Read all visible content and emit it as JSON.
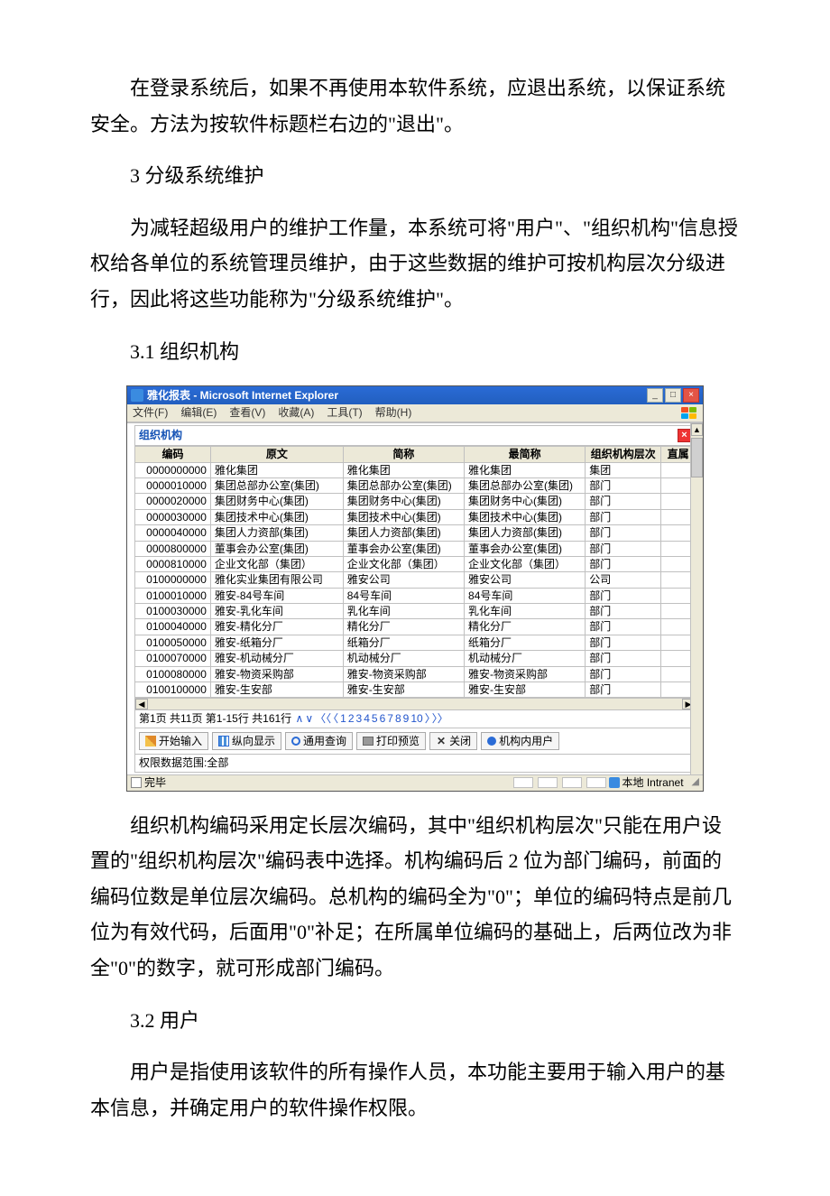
{
  "paragraphs": {
    "p1": "在登录系统后，如果不再使用本软件系统，应退出系统，以保证系统安全。方法为按软件标题栏右边的\"退出\"。",
    "h1": "3 分级系统维护",
    "p2": "为减轻超级用户的维护工作量，本系统可将\"用户\"、\"组织机构\"信息授权给各单位的系统管理员维护，由于这些数据的维护可按机构层次分级进行，因此将这些功能称为\"分级系统维护\"。",
    "h2": "3.1 组织机构",
    "p3": "组织机构编码采用定长层次编码，其中\"组织机构层次\"只能在用户设置的\"组织机构层次\"编码表中选择。机构编码后 2 位为部门编码，前面的编码位数是单位层次编码。总机构的编码全为\"0\"；单位的编码特点是前几位为有效代码，后面用\"0\"补足；在所属单位编码的基础上，后两位改为非全\"0\"的数字，就可形成部门编码。",
    "h3": "3.2 用户",
    "p4": "用户是指使用该软件的所有操作人员，本功能主要用于输入用户的基本信息，并确定用户的软件操作权限。"
  },
  "window": {
    "title": "雅化报表 - Microsoft Internet Explorer",
    "menus": [
      "文件(F)",
      "编辑(E)",
      "查看(V)",
      "收藏(A)",
      "工具(T)",
      "帮助(H)"
    ],
    "panel_title": "组织机构",
    "columns": [
      "编码",
      "原文",
      "简称",
      "最简称",
      "组织机构层次",
      "直属"
    ],
    "rows": [
      [
        "0000000000",
        "雅化集团",
        "雅化集团",
        "雅化集团",
        "集团",
        ""
      ],
      [
        "0000010000",
        "集团总部办公室(集团)",
        "集团总部办公室(集团)",
        "集团总部办公室(集团)",
        "部门",
        ""
      ],
      [
        "0000020000",
        "集团财务中心(集团)",
        "集团财务中心(集团)",
        "集团财务中心(集团)",
        "部门",
        ""
      ],
      [
        "0000030000",
        "集团技术中心(集团)",
        "集团技术中心(集团)",
        "集团技术中心(集团)",
        "部门",
        ""
      ],
      [
        "0000040000",
        "集团人力资部(集团)",
        "集团人力资部(集团)",
        "集团人力资部(集团)",
        "部门",
        ""
      ],
      [
        "0000800000",
        "董事会办公室(集团)",
        "董事会办公室(集团)",
        "董事会办公室(集团)",
        "部门",
        ""
      ],
      [
        "0000810000",
        "企业文化部（集团）",
        "企业文化部（集团）",
        "企业文化部（集团）",
        "部门",
        ""
      ],
      [
        "0100000000",
        "雅化实业集团有限公司",
        "雅安公司",
        "雅安公司",
        "公司",
        ""
      ],
      [
        "0100010000",
        "雅安-84号车间",
        "84号车间",
        "84号车间",
        "部门",
        ""
      ],
      [
        "0100030000",
        "雅安-乳化车间",
        "乳化车间",
        "乳化车间",
        "部门",
        ""
      ],
      [
        "0100040000",
        "雅安-精化分厂",
        "精化分厂",
        "精化分厂",
        "部门",
        ""
      ],
      [
        "0100050000",
        "雅安-纸箱分厂",
        "纸箱分厂",
        "纸箱分厂",
        "部门",
        ""
      ],
      [
        "0100070000",
        "雅安-机动械分厂",
        "机动械分厂",
        "机动械分厂",
        "部门",
        ""
      ],
      [
        "0100080000",
        "雅安-物资采购部",
        "雅安-物资采购部",
        "雅安-物资采购部",
        "部门",
        ""
      ],
      [
        "0100100000",
        "雅安-生安部",
        "雅安-生安部",
        "雅安-生安部",
        "部门",
        ""
      ]
    ],
    "pager_prefix": "第1页 共11页  第1-15行 共161行",
    "pager_links": [
      "∧",
      "∨",
      "〈〈",
      "〈",
      "1",
      "2",
      "3",
      "4",
      "5",
      "6",
      "7",
      "8",
      "9",
      "10",
      "〉",
      "〉〉"
    ],
    "toolbar": [
      {
        "label": "开始输入",
        "icon": "pen"
      },
      {
        "label": "纵向显示",
        "icon": "cols"
      },
      {
        "label": "通用查询",
        "icon": "find"
      },
      {
        "label": "打印预览",
        "icon": "print"
      },
      {
        "label": "关闭",
        "icon": "x"
      },
      {
        "label": "机构内用户",
        "icon": "user"
      }
    ],
    "scope_label": "权限数据范围:全部",
    "status_done": "完毕",
    "zone": "本地 Intranet"
  }
}
